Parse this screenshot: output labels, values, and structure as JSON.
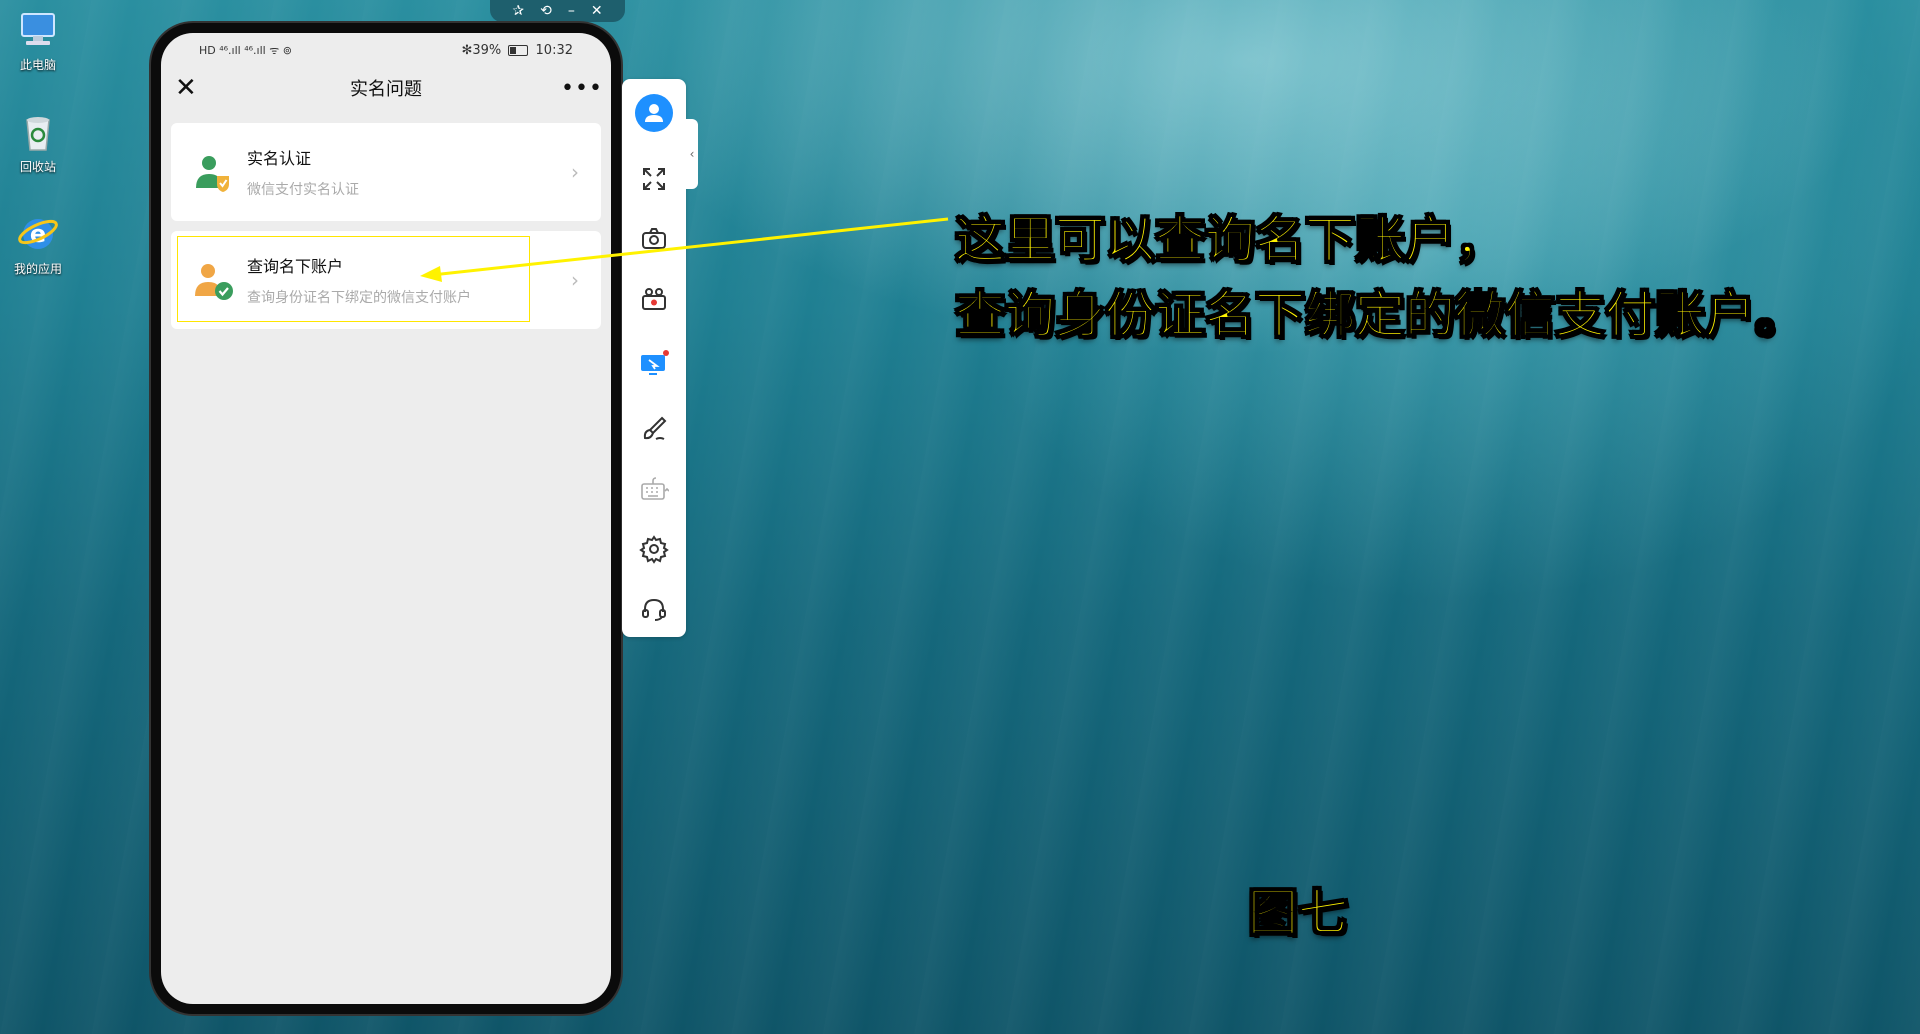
{
  "desktop": {
    "icons": [
      {
        "label": "此电脑",
        "icon": "computer-icon"
      },
      {
        "label": "回收站",
        "icon": "recycle-bin-icon"
      },
      {
        "label": "我的应用",
        "icon": "ie-browser-icon"
      }
    ]
  },
  "titlebar": {
    "pin": "✰",
    "restore": "⟲",
    "minimize": "–",
    "close": "✕"
  },
  "phone": {
    "status": {
      "left": "HD ⁴⁶.ıll ⁴⁶.ıll ᯤ ⊚",
      "battery": "✻39%",
      "time": "10:32"
    },
    "nav": {
      "close_glyph": "✕",
      "title": "实名问题",
      "more_glyph": "•••"
    },
    "items": [
      {
        "title": "实名认证",
        "subtitle": "微信支付实名认证",
        "chevron": "›",
        "icon": "verified-user-icon",
        "icon_color": "#3a9d5d"
      },
      {
        "title": "查询名下账户",
        "subtitle": "查询身份证名下绑定的微信支付账户",
        "chevron": "›",
        "icon": "account-check-icon",
        "icon_color": "#f0a645"
      }
    ]
  },
  "toolbar": {
    "items": [
      "avatar-icon",
      "fullscreen-icon",
      "camera-icon",
      "record-icon",
      "screen-cast-icon",
      "brush-icon",
      "keyboard-icon",
      "settings-icon",
      "headset-icon"
    ],
    "collapse_glyph": "‹"
  },
  "overlay": {
    "line1": "这里可以查询名下账户，",
    "line2": "查询身份证名下绑定的微信支付账户。",
    "label": "图七",
    "color": "#fff200"
  }
}
